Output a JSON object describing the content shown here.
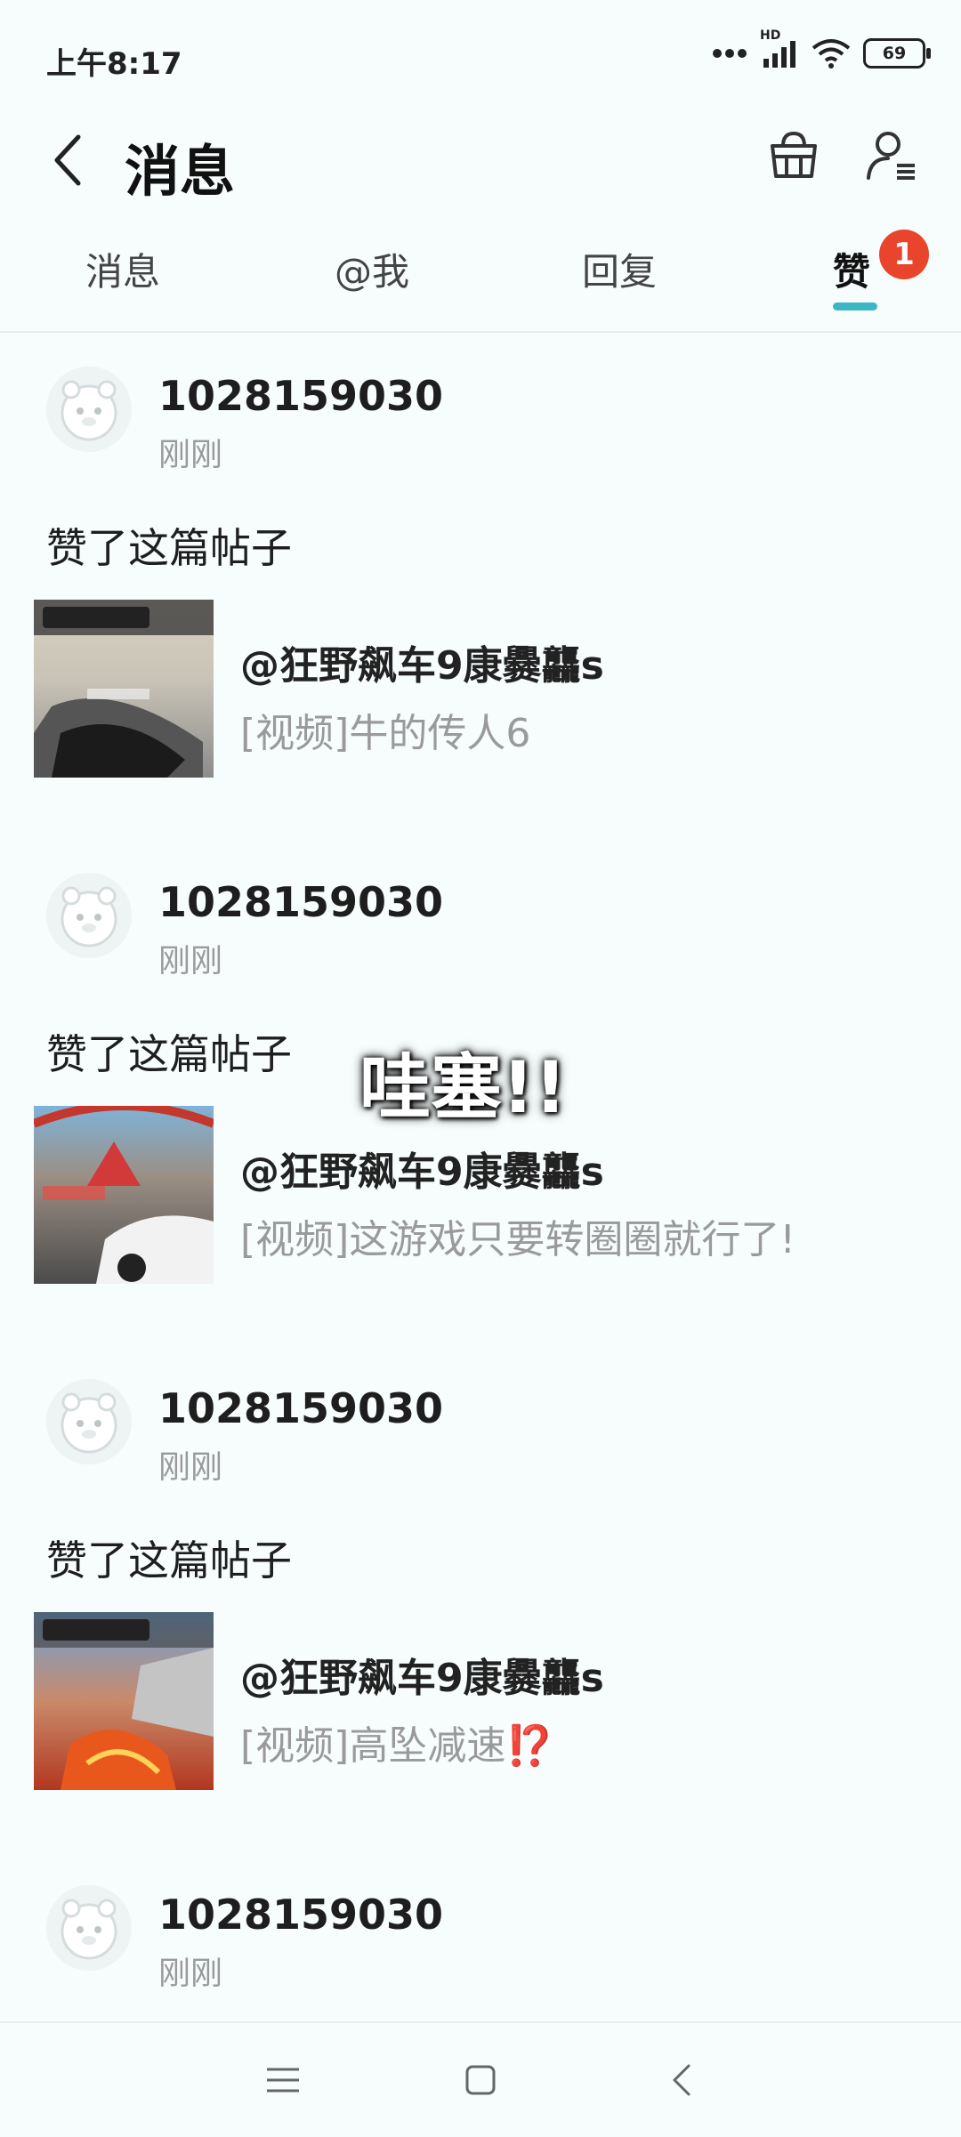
{
  "status_bar": {
    "time": "上午8:17",
    "battery": "69",
    "network": "HD"
  },
  "header": {
    "title": "消息"
  },
  "tabs": [
    {
      "label": "消息",
      "active": false
    },
    {
      "label": "@我",
      "active": false
    },
    {
      "label": "回复",
      "active": false
    },
    {
      "label": "赞",
      "active": true,
      "badge": "1"
    }
  ],
  "messages": [
    {
      "username": "1028159030",
      "time": "刚刚",
      "action": "赞了这篇帖子",
      "post": {
        "author": "@狂野飙车9康爨龘s",
        "title": "[视频]牛的传人6"
      }
    },
    {
      "username": "1028159030",
      "time": "刚刚",
      "action": "赞了这篇帖子",
      "post": {
        "author": "@狂野飙车9康爨龘s",
        "title": "[视频]这游戏只要转圈圈就行了!"
      }
    },
    {
      "username": "1028159030",
      "time": "刚刚",
      "action": "赞了这篇帖子",
      "post": {
        "author": "@狂野飙车9康爨龘s",
        "title": "[视频]高坠减速⁉️"
      }
    },
    {
      "username": "1028159030",
      "time": "刚刚"
    }
  ],
  "overlay": {
    "text": "哇塞!!"
  },
  "colors": {
    "accent": "#3bb7c4",
    "badge": "#e8452c",
    "muted_text": "#9a9a9a",
    "background": "#f7fcfd"
  }
}
